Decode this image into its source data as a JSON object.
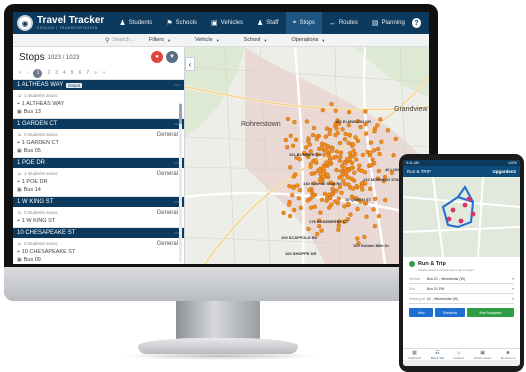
{
  "app": {
    "title": "Travel Tracker",
    "subtitle": "EDULOG | TRANSPORTATION"
  },
  "nav": [
    {
      "label": "Students",
      "icon": "student-icon",
      "glyph": "♟"
    },
    {
      "label": "Schools",
      "icon": "school-icon",
      "glyph": "⚑"
    },
    {
      "label": "Vehicles",
      "icon": "bus-icon",
      "glyph": "▣"
    },
    {
      "label": "Staff",
      "icon": "person-icon",
      "glyph": "♟"
    },
    {
      "label": "Stops",
      "icon": "stop-pin-icon",
      "glyph": "⌖",
      "active": true
    },
    {
      "label": "Routes",
      "icon": "routes-icon",
      "glyph": "↔"
    },
    {
      "label": "Planning",
      "icon": "planning-icon",
      "glyph": "▤"
    }
  ],
  "search": {
    "placeholder": "Search..."
  },
  "filters": [
    "Filters",
    "Vehicle",
    "School",
    "Operations"
  ],
  "stops": {
    "title": "Stops",
    "count": "1023 / 1023",
    "pages": [
      "1",
      "2",
      "3",
      "4",
      "5",
      "6",
      "7"
    ],
    "items": [
      {
        "name": "1 ALTHEAS WAY",
        "badge": "Depot",
        "students": "1 students assoc",
        "address": "1 ALTHEAS WAY",
        "bus": "Bus 13",
        "type": ""
      },
      {
        "name": "1 GARDEN CT",
        "badge": "",
        "students": "0 students assoc",
        "address": "1 GARDEN CT",
        "bus": "Bus 05",
        "type": "General"
      },
      {
        "name": "1 POE DR",
        "badge": "",
        "students": "1 students assoc",
        "address": "1 POE DR",
        "bus": "Bus 14",
        "type": "General"
      },
      {
        "name": "1 W KING ST",
        "badge": "",
        "students": "0 students assoc",
        "address": "1 W KING ST",
        "bus": "",
        "type": "General"
      },
      {
        "name": "10 CHESAPEAKE ST",
        "badge": "",
        "students": "0 students assoc",
        "address": "10 CHESAPEAKE ST",
        "bus": "Bus 09",
        "type": "General"
      }
    ]
  },
  "map": {
    "places": [
      "Rohrerstown",
      "Grandview"
    ],
    "stop_labels": [
      "102 ELMWOOD DR",
      "101 BOMBER DR",
      "140 Schnuk Stop Rd",
      "132 MORNING STAR ST",
      "10 QUEEN ST",
      "178 ROSEBERRY CT",
      "100 SCAFFOLD RD",
      "100 Golden Mile Dr",
      "160 SHOPPE DR",
      "40 LONGVIEW DR"
    ],
    "colors": {
      "stop": "#f28c1e",
      "road": "#ffffff",
      "urban": "#e7c6c1"
    }
  },
  "phone": {
    "status_left": "9:41 AM",
    "status_right": "100%",
    "header_left": "Run & TRIP",
    "header_right": "Upgarden2",
    "card_title": "Run & Trip",
    "card_sub": "Please select a vehicle and route to begin",
    "fields": [
      {
        "label": "Vehicle",
        "value": "Bus 01 - Wheelchair (W)"
      },
      {
        "label": "Run",
        "value": "Bus 01 PM"
      },
      {
        "label": "Starting at",
        "value": "#1 - Wheelchair (W)"
      }
    ],
    "buttons": [
      {
        "label": "View",
        "color": "#1f6fd1"
      },
      {
        "label": "Directions",
        "color": "#1f6fd1"
      },
      {
        "label": "Start Navigation",
        "color": "#2e9d45"
      }
    ],
    "nav": [
      {
        "label": "Dashboard",
        "icon": "dashboard-icon",
        "glyph": "▦"
      },
      {
        "label": "Run & Trip",
        "icon": "route-icon",
        "glyph": "☷",
        "active": true
      },
      {
        "label": "Students",
        "icon": "students-icon",
        "glyph": "☺"
      },
      {
        "label": "Vehicle Status",
        "icon": "vehicle-icon",
        "glyph": "▣"
      },
      {
        "label": "My Account",
        "icon": "account-icon",
        "glyph": "☻"
      }
    ]
  }
}
